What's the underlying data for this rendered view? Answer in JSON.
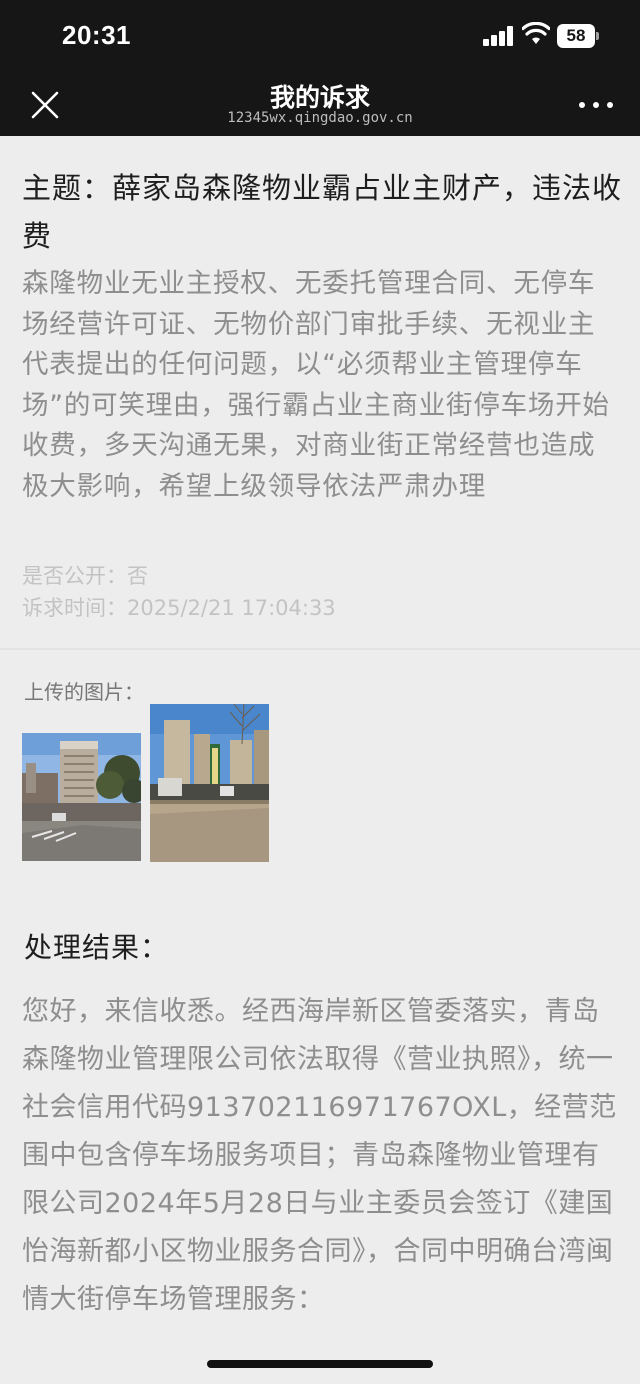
{
  "status_bar": {
    "time": "20:31",
    "battery_level": "58",
    "icons": [
      "signal-icon",
      "wifi-icon",
      "battery-icon"
    ]
  },
  "nav": {
    "title": "我的诉求",
    "subtitle": "12345wx.qingdao.gov.cn",
    "icons": [
      "close-icon",
      "more-icon"
    ]
  },
  "request": {
    "subject": "主题：薛家岛森隆物业霸占业主财产，违法收费",
    "description": "森隆物业无业主授权、无委托管理合同、无停车场经营许可证、无物价部门审批手续、无视业主代表提出的任何问题，以“必须帮业主管理停车场”的可笑理由，强行霸占业主商业街停车场开始收费，多天沟通无果，对商业街正常经营也造成极大影响，希望上级领导依法严肃办理",
    "is_public": "是否公开：否",
    "request_time": "诉求时间：2025/2/21 17:04:33"
  },
  "uploads": {
    "label": "上传的图片："
  },
  "result": {
    "title": "处理结果：",
    "text": "您好，来信收悉。经西海岸新区管委落实，青岛森隆物业管理限公司依法取得《营业执照》，统一社会信用代码913702116971767OXL，经营范围中包含停车场服务项目；青岛森隆物业管理有限公司2024年5月28日与业主委员会签订《建国怡海新都小区物业服务合同》，合同中明确台湾闽情大街停车场管理服务："
  },
  "colors": {
    "header_bg": "#161616",
    "page_bg": "#ededed",
    "gray_text": "#8e8e8e"
  }
}
